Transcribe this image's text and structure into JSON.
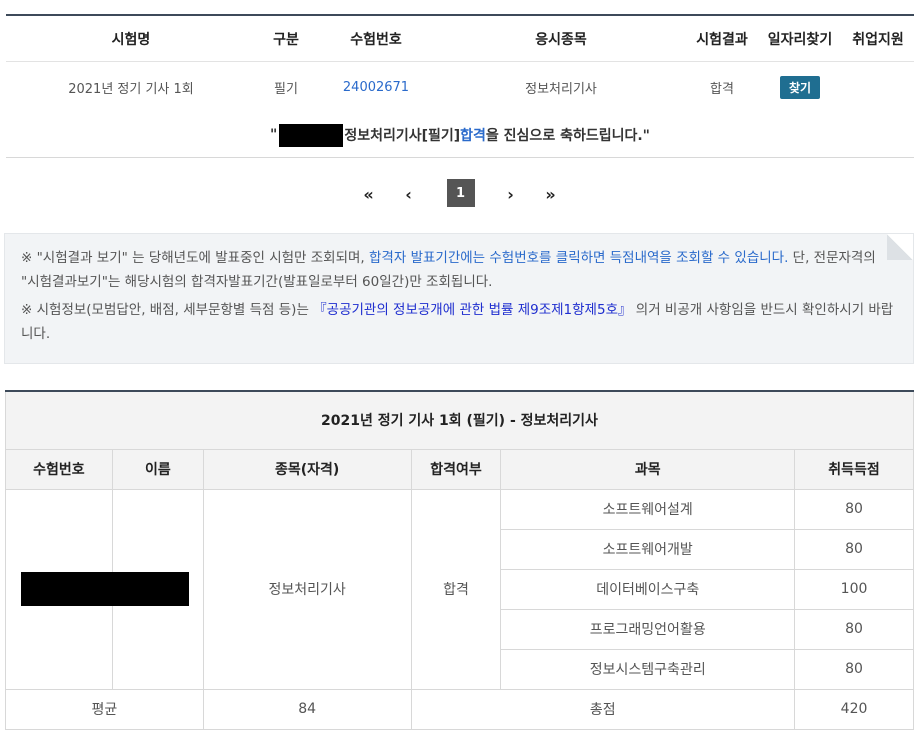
{
  "top_table": {
    "headers": [
      "시험명",
      "구분",
      "수험번호",
      "응시종목",
      "시험결과",
      "일자리찾기",
      "취업지원"
    ],
    "row": {
      "exam_name": "2021년 정기 기사 1회",
      "type": "필기",
      "exam_number": "24002671",
      "subject": "정보처리기사",
      "result": "합격",
      "find_button": "찾기"
    },
    "congrats": {
      "open_quote": "\"",
      "pre": "정보처리기사[필기] ",
      "pass": "합격",
      "post": "을 진심으로 축하드립니다.\""
    }
  },
  "pagination": {
    "first": "«",
    "prev": "‹",
    "current": "1",
    "next": "›",
    "last": "»"
  },
  "notice": {
    "line1_a": "※ \"시험결과 보기\" 는 당해년도에 발표중인 시험만 조회되며, ",
    "line1_b": "합격자 발표기간에는 수험번호를 클릭하면 득점내역을 조회할 수 있습니다.",
    "line1_c": " 단, 전문자격의 \"시험결과보기\"는 해당시험의 합격자발표기간(발표일로부터 60일간)만 조회됩니다.",
    "line2_a": "※ 시험정보(모범답안, 배점, 세부문항별 득점 등)는 ",
    "line2_b": "『공공기관의 정보공개에 관한 법률 제9조제1항제5호』",
    "line2_c": " 의거 비공개 사항임을 반드시 확인하시기 바랍니다."
  },
  "score_table": {
    "title": "2021년 정기 기사 1회 (필기) - 정보처리기사",
    "headers": [
      "수험번호",
      "이름",
      "종목(자격)",
      "합격여부",
      "과목",
      "취득득점"
    ],
    "qualification": "정보처리기사",
    "pass_status": "합격",
    "subjects": [
      {
        "name": "소프트웨어설계",
        "score": "80"
      },
      {
        "name": "소프트웨어개발",
        "score": "80"
      },
      {
        "name": "데이터베이스구축",
        "score": "100"
      },
      {
        "name": "프로그래밍언어활용",
        "score": "80"
      },
      {
        "name": "정보시스템구축관리",
        "score": "80"
      }
    ],
    "average_label": "평균",
    "average_value": "84",
    "total_label": "총점",
    "total_value": "420"
  },
  "colors": {
    "accent_blue": "#2a6acb",
    "button_teal": "#1f6e91",
    "header_border": "#3d4a5a"
  }
}
